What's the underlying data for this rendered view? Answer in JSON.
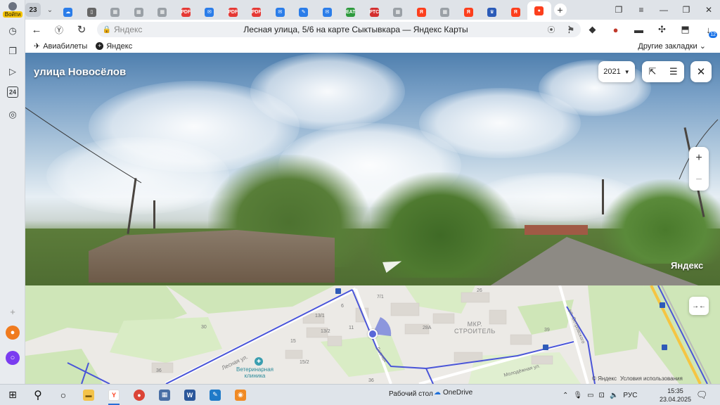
{
  "sidebar": {
    "login_label": "Войти",
    "calendar_day": "24"
  },
  "tabs": {
    "count": "23",
    "items": [
      {
        "favicon": "cloud-mail",
        "color": "#2b7de9",
        "text": "☁"
      },
      {
        "favicon": "doc",
        "color": "#666666",
        "text": "▯"
      },
      {
        "favicon": "grid",
        "color": "#9aa0a6",
        "text": "▦"
      },
      {
        "favicon": "grid",
        "color": "#9aa0a6",
        "text": "▦"
      },
      {
        "favicon": "grid",
        "color": "#9aa0a6",
        "text": "▦"
      },
      {
        "favicon": "pdf",
        "color": "#e53935",
        "text": "PDF"
      },
      {
        "favicon": "mail",
        "color": "#2b7de9",
        "text": "✉"
      },
      {
        "favicon": "pdf",
        "color": "#e53935",
        "text": "PDF"
      },
      {
        "favicon": "pdf",
        "color": "#e53935",
        "text": "PDF"
      },
      {
        "favicon": "mail",
        "color": "#2b7de9",
        "text": "✉"
      },
      {
        "favicon": "edit",
        "color": "#2b7de9",
        "text": "✎"
      },
      {
        "favicon": "mail",
        "color": "#2b7de9",
        "text": "✉"
      },
      {
        "favicon": "eat",
        "color": "#2e9a3e",
        "text": "EAT"
      },
      {
        "favicon": "rtc",
        "color": "#d32f2f",
        "text": "РТС"
      },
      {
        "favicon": "grid",
        "color": "#9aa0a6",
        "text": "▦"
      },
      {
        "favicon": "yandex",
        "color": "#fc3f1d",
        "text": "Я"
      },
      {
        "favicon": "grid",
        "color": "#9aa0a6",
        "text": "▦"
      },
      {
        "favicon": "yandex",
        "color": "#fc3f1d",
        "text": "Я"
      },
      {
        "favicon": "shield",
        "color": "#2b5bb8",
        "text": "♛"
      },
      {
        "favicon": "yandex",
        "color": "#fc3f1d",
        "text": "Я"
      },
      {
        "favicon": "maps-pin",
        "color": "#fc3f1d",
        "text": "●",
        "active": true
      }
    ]
  },
  "address_bar": {
    "domain": "Яндекс",
    "title": "Лесная улица, 5/6 на карте Сыктывкара — Яндекс Карты",
    "downloads_badge": "12"
  },
  "bookmarks": {
    "items": [
      {
        "icon": "plane-icon",
        "label": "Авиабилеты"
      },
      {
        "icon": "plus-icon",
        "label": "Яндекс"
      }
    ],
    "other": "Другие закладки"
  },
  "panorama": {
    "street": "улица Новосёлов",
    "year": "2021",
    "logo": "Яндекс"
  },
  "map": {
    "district": "МКР.\nСТРОИТЕЛЬ",
    "streets": [
      "Лесная ул.",
      "Лесная",
      "ул. Островского",
      "Молодёжная ул."
    ],
    "vet": "Ветеринарная\nклиника",
    "house_numbers": [
      "30",
      "13/1",
      "13/2",
      "11",
      "15",
      "15/2",
      "36",
      "7/1",
      "6",
      "28А",
      "26",
      "39",
      "36"
    ],
    "copyright": "© Яндекс",
    "terms": "Условия использования"
  },
  "taskbar": {
    "desktop": "Рабочий стол",
    "onedrive": "OneDrive",
    "lang": "РУС",
    "time": "15:35",
    "date": "23.04.2025"
  },
  "colors": {
    "yandex_red": "#fc3f1d",
    "route_blue": "#4a55d8",
    "map_green": "#cfe6b8"
  }
}
